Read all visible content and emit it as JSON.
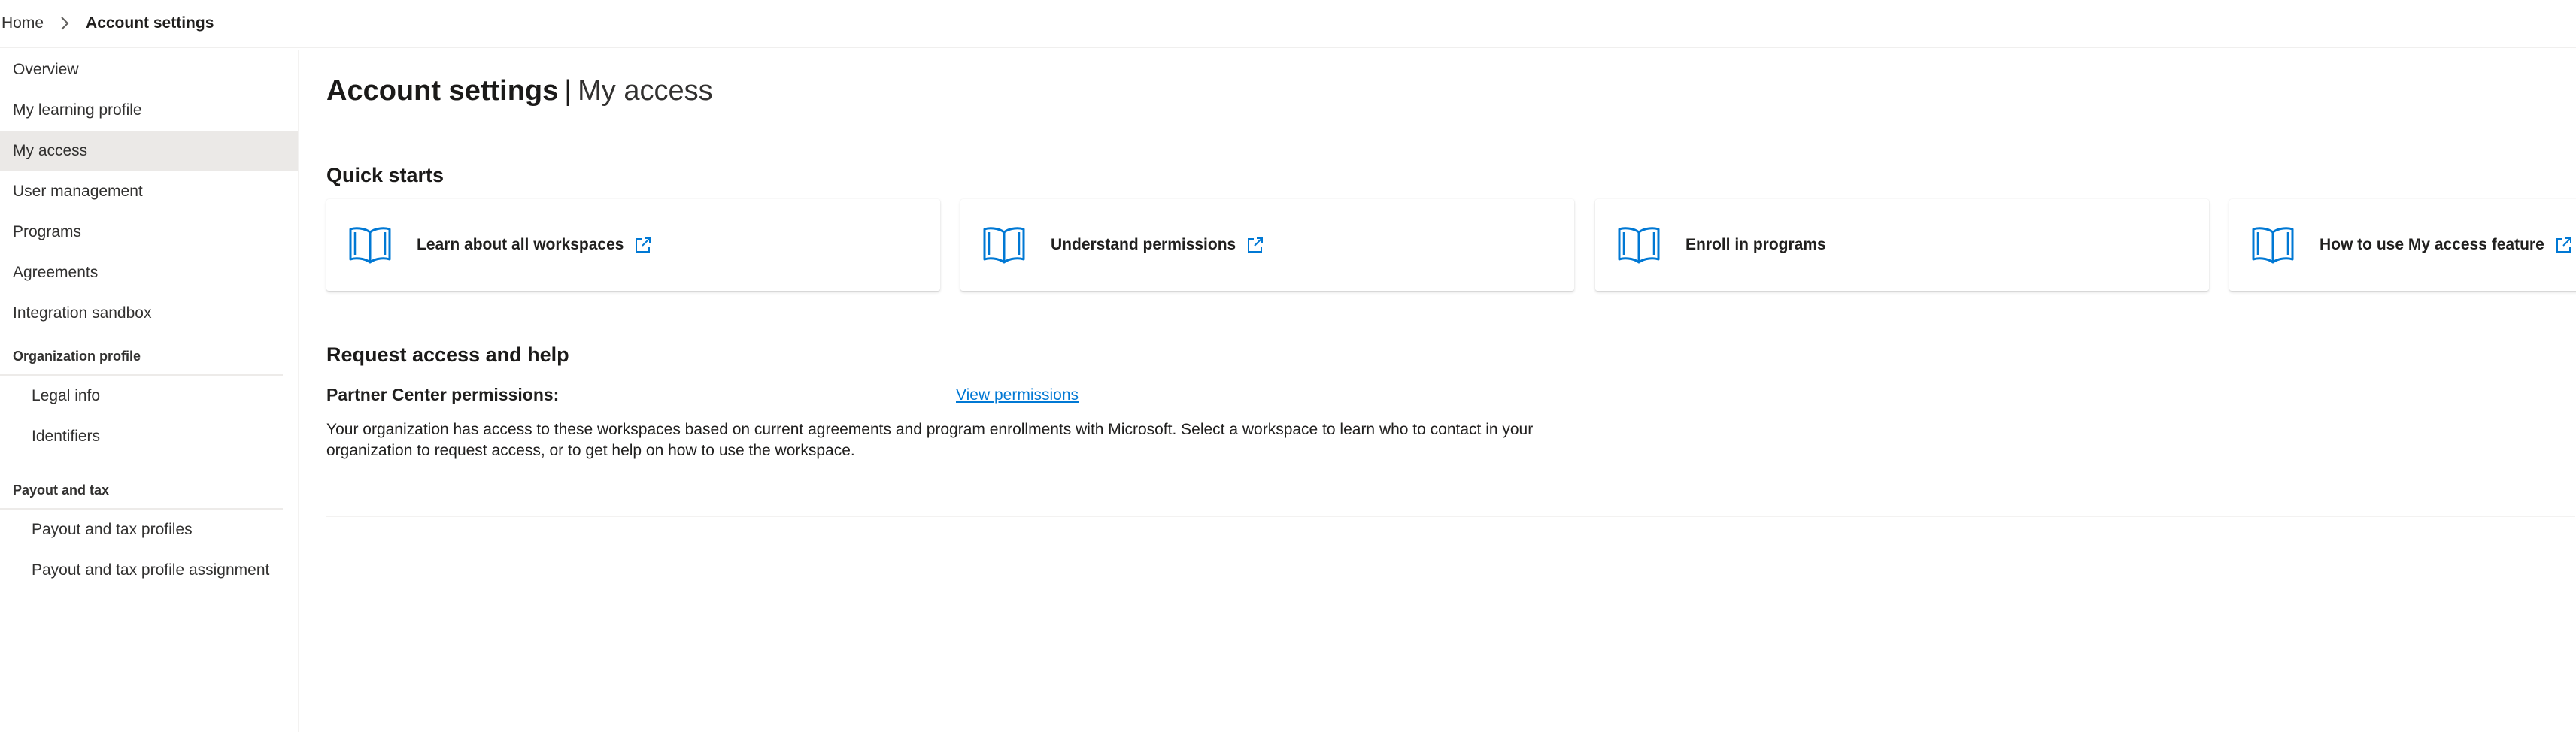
{
  "breadcrumb": {
    "home": "Home",
    "current": "Account settings"
  },
  "sidebar": {
    "items": [
      {
        "label": "Overview"
      },
      {
        "label": "My learning profile"
      },
      {
        "label": "My access",
        "active": true
      },
      {
        "label": "User management"
      },
      {
        "label": "Programs"
      },
      {
        "label": "Agreements"
      },
      {
        "label": "Integration sandbox"
      }
    ],
    "org_section": {
      "title": "Organization profile",
      "items": [
        {
          "label": "Legal info"
        },
        {
          "label": "Identifiers"
        }
      ]
    },
    "payout_section": {
      "title": "Payout and tax",
      "items": [
        {
          "label": "Payout and tax profiles"
        },
        {
          "label": "Payout and tax profile assignment"
        }
      ]
    }
  },
  "page": {
    "title": "Account settings",
    "separator": "|",
    "subtitle": "My access"
  },
  "quick_starts": {
    "heading": "Quick starts",
    "cards": [
      {
        "label": "Learn about all workspaces",
        "icon": "book-icon",
        "external": true
      },
      {
        "label": "Understand permissions",
        "icon": "book-icon",
        "external": true
      },
      {
        "label": "Enroll in programs",
        "icon": "book-icon",
        "external": false
      },
      {
        "label": "How to use My access feature",
        "icon": "book-icon",
        "external": true
      }
    ]
  },
  "request_access": {
    "heading": "Request access and help",
    "permissions_label": "Partner Center permissions:",
    "permissions_link": "View permissions",
    "description": "Your organization has access to these workspaces based on current agreements and program enrollments with Microsoft. Select a workspace to learn who to contact in your organization to request access, or to get help on how to use the workspace."
  },
  "colors": {
    "accent": "#0078d4",
    "active_nav_bg": "#ebe9e7"
  }
}
